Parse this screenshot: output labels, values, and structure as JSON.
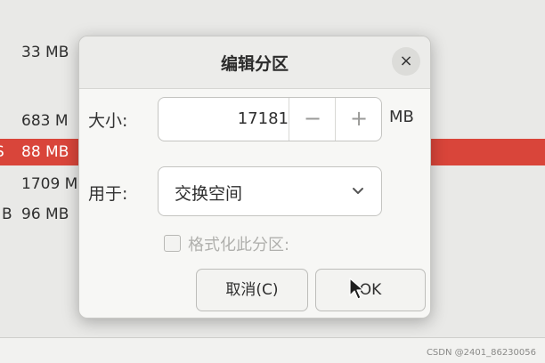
{
  "background": {
    "rows": [
      {
        "prefix": "",
        "size": "33 MB"
      },
      {
        "prefix": "",
        "size": "683 M"
      },
      {
        "prefix": "S",
        "size": "88 MB"
      },
      {
        "prefix": "",
        "size": "1709 M"
      },
      {
        "prefix": "B",
        "size": "96 MB"
      }
    ],
    "selected_color": "#d9453a"
  },
  "dialog": {
    "title": "编辑分区",
    "close_glyph": "×",
    "size_label": "大小:",
    "size_value": "17181",
    "decrement_glyph": "−",
    "increment_glyph": "+",
    "unit": "MB",
    "use_label": "用于:",
    "use_value": "交换空间",
    "format_label": "格式化此分区:",
    "format_checked": false,
    "cancel_label": "取消(C)",
    "ok_label": "OK"
  },
  "watermark": "CSDN @2401_86230056",
  "icons": {
    "close": "close-icon",
    "dropdown": "chevron-down-icon",
    "cursor": "mouse-pointer-icon"
  }
}
